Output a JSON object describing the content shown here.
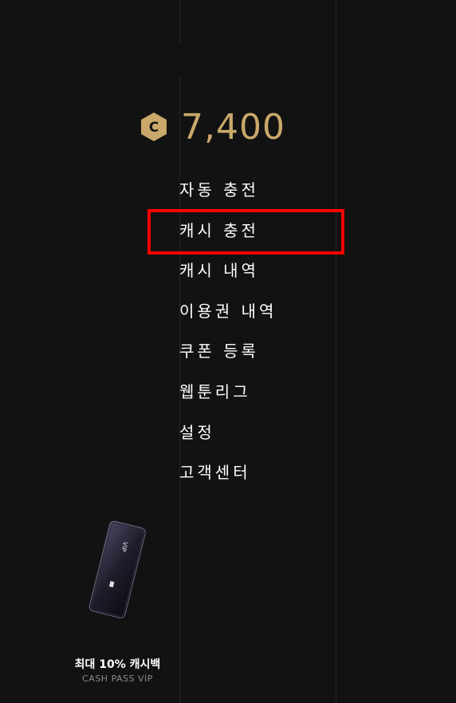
{
  "wallet": {
    "balance": "7,400",
    "coin_icon": "coin-c-icon",
    "accent_color": "#c9a86a"
  },
  "menu": {
    "items": [
      {
        "label": "자동 충전"
      },
      {
        "label": "캐시 충전"
      },
      {
        "label": "캐시 내역"
      },
      {
        "label": "이용권 내역"
      },
      {
        "label": "쿠폰 등록"
      },
      {
        "label": "웹툰리그"
      },
      {
        "label": "설정"
      },
      {
        "label": "고객센터"
      }
    ],
    "highlighted_index": 1,
    "highlight_color": "#ff0000"
  },
  "promo": {
    "card_text": "VIP",
    "title": "최대 10% 캐시백",
    "subtitle": "CASH PASS VIP"
  }
}
